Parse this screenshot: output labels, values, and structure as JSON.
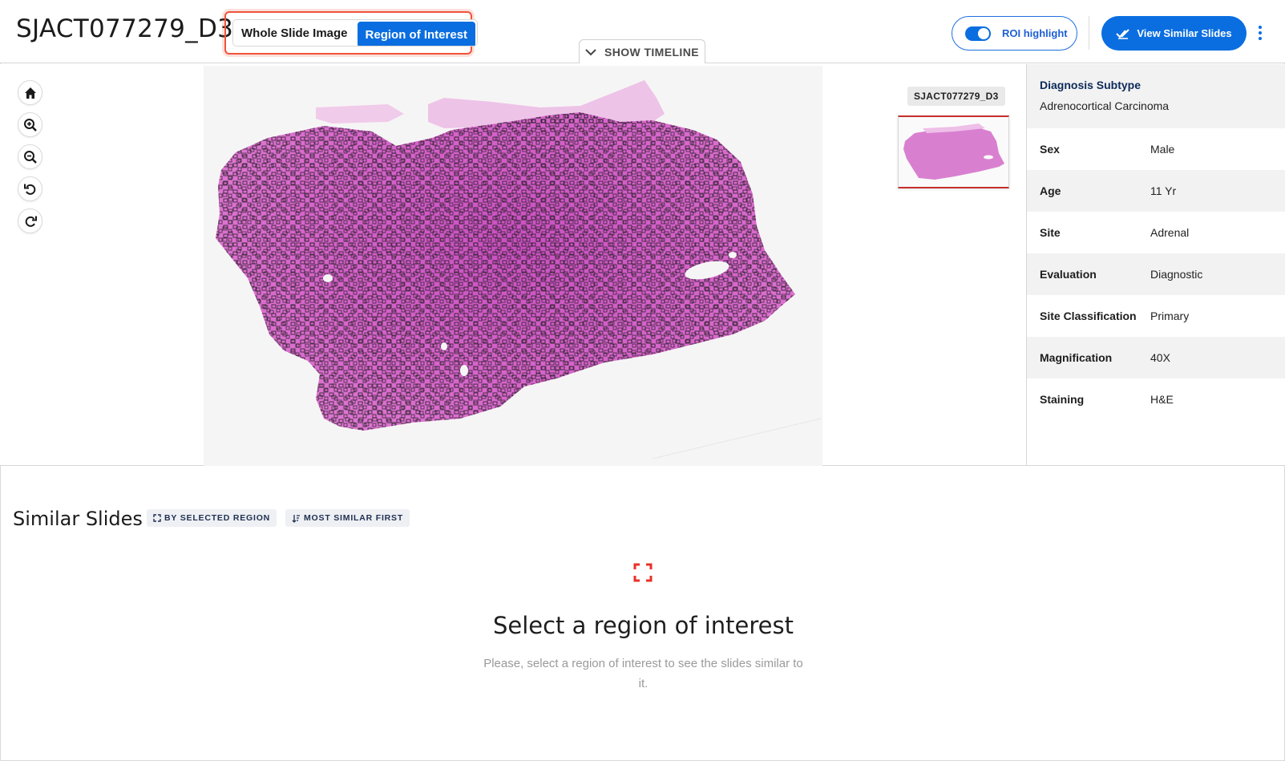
{
  "header": {
    "slide_id": "SJACT077279_D3",
    "view_modes": {
      "whole_slide": "Whole Slide Image",
      "roi": "Region of Interest",
      "active": "Region of Interest"
    },
    "timeline_label": "SHOW TIMELINE",
    "roi_highlight": {
      "label": "ROI highlight",
      "enabled": true
    },
    "view_similar_label": "View Similar Slides"
  },
  "viewer": {
    "tools": [
      "home-icon",
      "zoom-in-icon",
      "zoom-out-icon",
      "rotate-left-icon",
      "rotate-right-icon"
    ],
    "minimap_label": "SJACT077279_D3",
    "tissue_color": "#d663c9",
    "roi_marker_color": "#1a1a1a"
  },
  "info": {
    "diagnosis": {
      "label": "Diagnosis Subtype",
      "value": "Adrenocortical Carcinoma"
    },
    "rows": [
      {
        "label": "Sex",
        "value": "Male"
      },
      {
        "label": "Age",
        "value": "11 Yr"
      },
      {
        "label": "Site",
        "value": "Adrenal"
      },
      {
        "label": "Evaluation",
        "value": "Diagnostic"
      },
      {
        "label": "Site Classification",
        "value": "Primary"
      },
      {
        "label": "Magnification",
        "value": "40X"
      },
      {
        "label": "Staining",
        "value": "H&E"
      }
    ]
  },
  "similar": {
    "title": "Similar Slides",
    "filter_region": "BY SELECTED REGION",
    "sort_order": "MOST SIMILAR FIRST",
    "empty_title": "Select a region of interest",
    "empty_text": "Please, select a region of interest to see the slides similar to it."
  },
  "colors": {
    "accent": "#0a6ee0",
    "highlight_outline": "#f0533a",
    "empty_icon": "#e8312a"
  }
}
